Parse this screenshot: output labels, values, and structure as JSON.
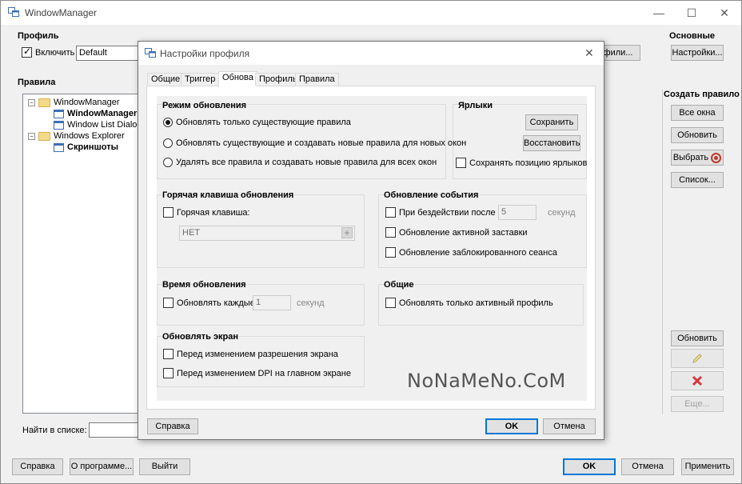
{
  "window": {
    "title": "WindowManager",
    "minimize": "—",
    "maximize": "☐",
    "close": "✕"
  },
  "profile": {
    "section_title": "Профиль",
    "enable_label": "Включить",
    "enable_checked": true,
    "profile_value": "Default",
    "profiles_button_partial": "фили..."
  },
  "main_section": {
    "title": "Основные",
    "settings_button": "Настройки..."
  },
  "rules": {
    "section_title": "Правила",
    "tree": [
      {
        "label": "WindowManager",
        "type": "folder",
        "expander": "−",
        "bold": false
      },
      {
        "label": "WindowManager",
        "type": "window",
        "bold": true
      },
      {
        "label": "Window List Dialog",
        "type": "window",
        "bold": false
      },
      {
        "label": "Windows Explorer",
        "type": "folder",
        "expander": "−",
        "bold": false
      },
      {
        "label": "Скриншоты",
        "type": "window",
        "bold": true
      }
    ],
    "search_label": "Найти в списке:",
    "search_value": ""
  },
  "create_rule": {
    "title": "Создать правило",
    "all_windows_button": "Все окна",
    "update_button": "Обновить",
    "select_button": "Выбрать",
    "list_button": "Список...",
    "refresh_button": "Обновить",
    "edit_icon": "pencil-icon",
    "delete_icon": "delete-icon",
    "more_button": "Еще..."
  },
  "bottom_bar": {
    "help": "Справка",
    "about": "О программе...",
    "exit": "Выйти",
    "ok": "OK",
    "cancel": "Отмена",
    "apply": "Применить"
  },
  "dialog": {
    "title": "Настройки профиля",
    "close": "✕",
    "tabs": [
      "Общие",
      "Триггер",
      "Обнова",
      "Профиль",
      "Правила"
    ],
    "active_tab": "Обнова",
    "update_mode": {
      "title": "Режим обновления",
      "options": [
        {
          "label": "Обновлять только существующие правила",
          "checked": true
        },
        {
          "label": "Обновлять существующие и создавать новые правила для новых окон",
          "checked": false
        },
        {
          "label": "Удалять все правила и создавать новые правила для всех окон",
          "checked": false
        }
      ]
    },
    "shortcuts": {
      "title": "Ярлыки",
      "save_button": "Сохранить",
      "restore_button": "Восстановить",
      "keep_position_label": "Сохранять позицию ярлыков",
      "keep_position_checked": false
    },
    "hotkey": {
      "title": "Горячая клавиша обновления",
      "hotkey_label": "Горячая клавиша:",
      "hotkey_checked": false,
      "hotkey_value": "НЕТ",
      "plus": "+"
    },
    "event_update": {
      "title": "Обновление события",
      "idle_label": "При бездействии после",
      "idle_checked": false,
      "idle_value": "5",
      "idle_unit": "секунд",
      "screensaver_label": "Обновление активной заставки",
      "screensaver_checked": false,
      "locked_label": "Обновление заблокированного сеанса",
      "locked_checked": false
    },
    "update_time": {
      "title": "Время обновления",
      "every_label": "Обновлять каждые",
      "every_checked": false,
      "every_value": "1",
      "every_unit": "секунд"
    },
    "general": {
      "title": "Общие",
      "active_only_label": "Обновлять только активный профиль",
      "active_only_checked": false
    },
    "screen_update": {
      "title": "Обновлять экран",
      "resolution_label": "Перед изменением разрешения экрана",
      "resolution_checked": false,
      "dpi_label": "Перед изменением DPI на главном экране",
      "dpi_checked": false
    },
    "help_button": "Справка",
    "ok_button": "OK",
    "cancel_button": "Отмена"
  },
  "watermark": "NoNaMeNo.CoM"
}
